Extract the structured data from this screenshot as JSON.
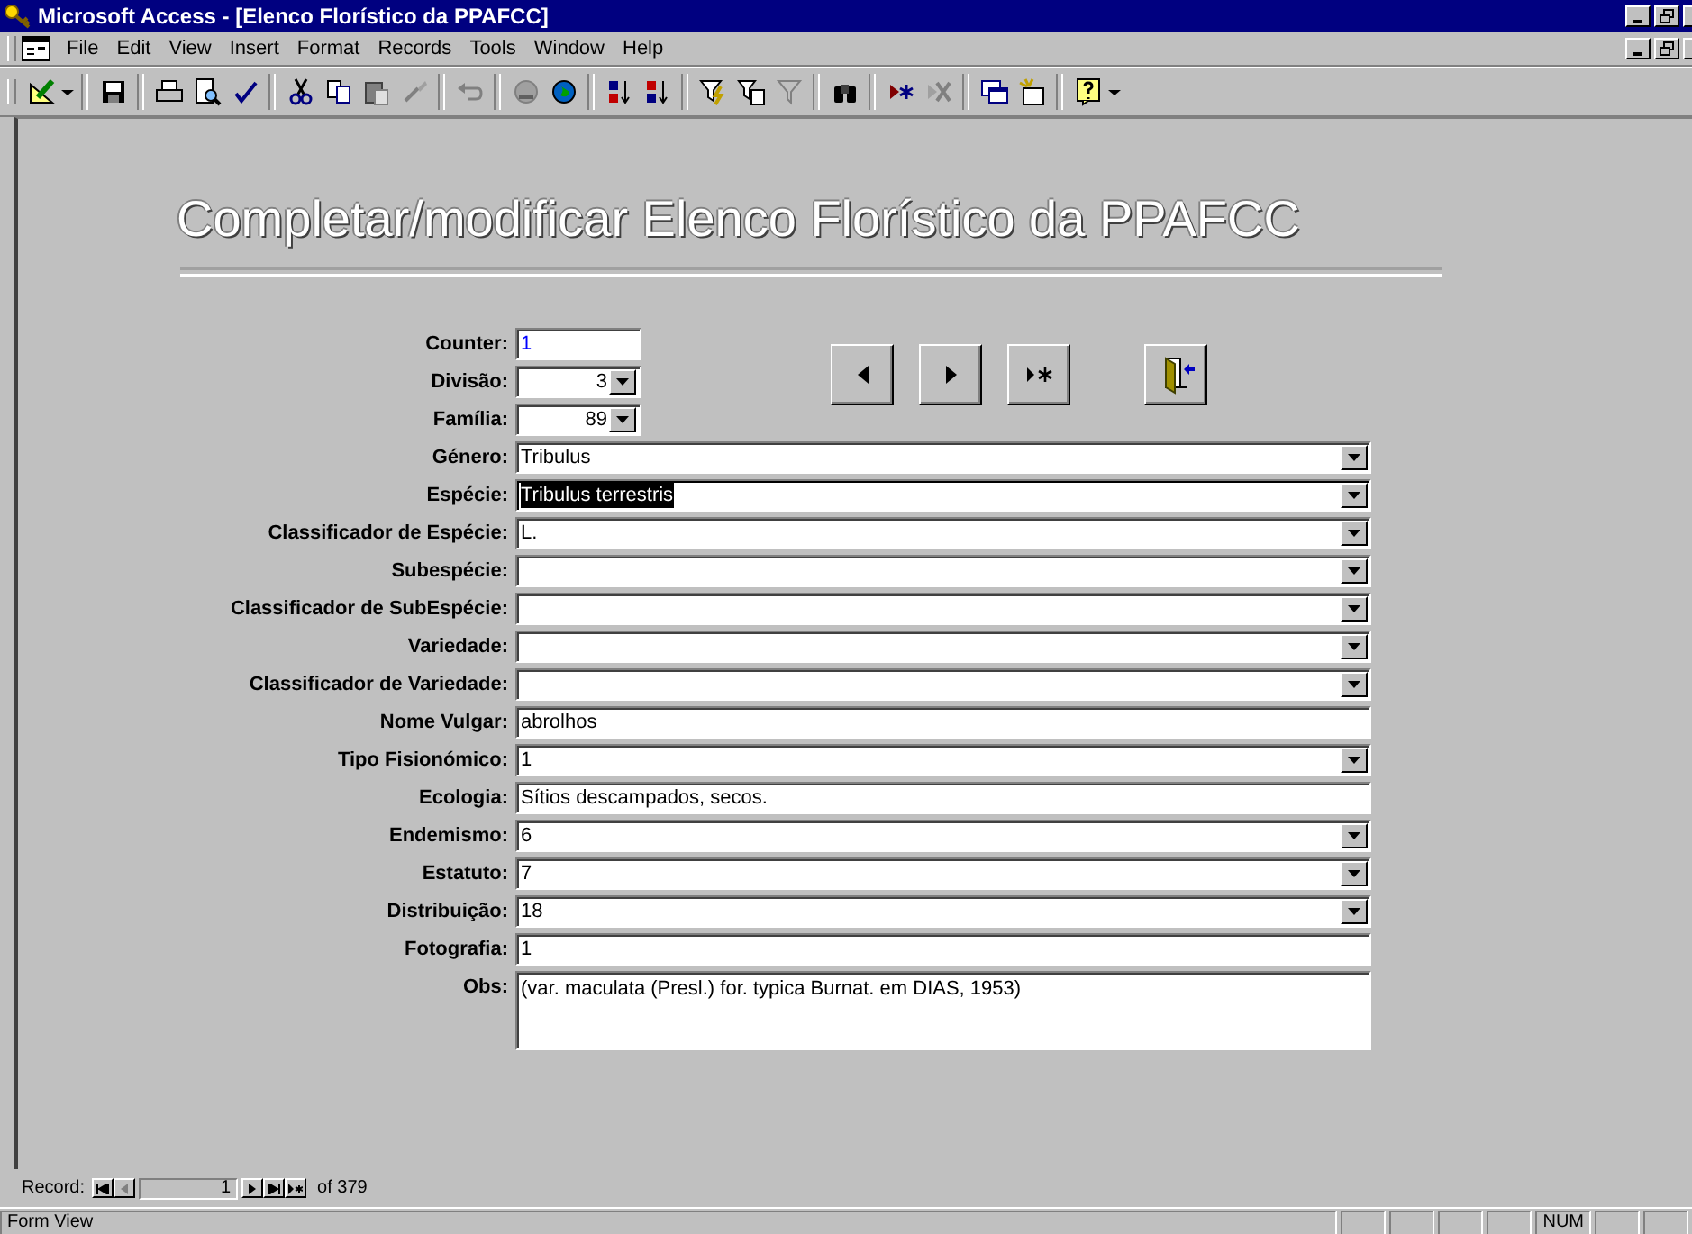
{
  "window": {
    "title": "Microsoft Access - [Elenco Florístico da PPAFCC]"
  },
  "menu": [
    "File",
    "Edit",
    "View",
    "Insert",
    "Format",
    "Records",
    "Tools",
    "Window",
    "Help"
  ],
  "form": {
    "heading": "Completar/modificar Elenco Florístico da PPAFCC",
    "fields": [
      {
        "label": "Counter:",
        "value": "1",
        "kind": "counter",
        "selected": false
      },
      {
        "label": "Divisão:",
        "value": "3",
        "kind": "short-combo",
        "selected": false
      },
      {
        "label": "Família:",
        "value": "89",
        "kind": "short-combo",
        "selected": false
      },
      {
        "label": "Género:",
        "value": "Tribulus",
        "kind": "combo",
        "selected": false
      },
      {
        "label": "Espécie:",
        "value": "Tribulus terrestris",
        "kind": "combo",
        "selected": true
      },
      {
        "label": "Classificador de Espécie:",
        "value": "L.",
        "kind": "combo",
        "selected": false
      },
      {
        "label": "Subespécie:",
        "kind": "combo",
        "selected": false
      },
      {
        "label": "Classificador de SubEspécie:",
        "kind": "combo",
        "selected": false
      },
      {
        "label": "Variedade:",
        "kind": "combo",
        "selected": false
      },
      {
        "label": "Classificador de Variedade:",
        "kind": "combo",
        "selected": false
      },
      {
        "label": "Nome Vulgar:",
        "value": "abrolhos",
        "kind": "text",
        "selected": false
      },
      {
        "label": "Tipo Fisionómico:",
        "value": "1",
        "kind": "combo",
        "selected": false
      },
      {
        "label": "Ecologia:",
        "value": "Sítios descampados, secos.",
        "kind": "text",
        "selected": false
      },
      {
        "label": "Endemismo:",
        "value": "6",
        "kind": "combo",
        "selected": false
      },
      {
        "label": "Estatuto:",
        "value": "7",
        "kind": "combo",
        "selected": false
      },
      {
        "label": "Distribuição:",
        "value": "18",
        "kind": "combo",
        "selected": false
      },
      {
        "label": "Fotografia:",
        "value": "1",
        "kind": "text",
        "selected": false
      },
      {
        "label": "Obs:",
        "value": "(var. maculata (Presl.) for. typica Burnat. em DIAS, 1953)",
        "kind": "memo",
        "selected": false
      }
    ]
  },
  "record_nav": {
    "label": "Record:",
    "current": "1",
    "total": "of 379"
  },
  "status_bar": {
    "text": "Form View",
    "indicators": [
      "NUM"
    ]
  }
}
